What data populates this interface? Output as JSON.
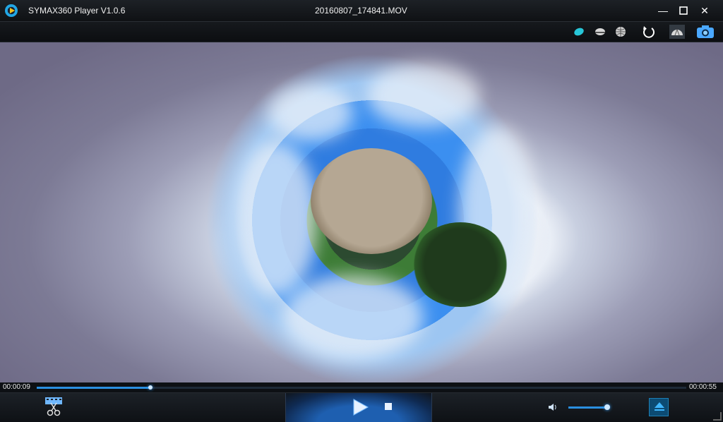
{
  "window": {
    "app_title": "SYMAX360 Player V1.0.6",
    "file_title": "20160807_174841.MOV",
    "minimize_glyph": "—",
    "maximize_glyph": "☐",
    "close_glyph": "✕"
  },
  "toolbar": {
    "buttons": [
      {
        "name": "little-planet-view-icon",
        "color": "#27c6d8"
      },
      {
        "name": "fisheye-view-icon",
        "color": "#d8d8d8"
      },
      {
        "name": "globe-view-icon",
        "color": "#d8d8d8"
      },
      {
        "name": "rotate-reset-icon",
        "color": "#ffffff"
      },
      {
        "name": "dome-view-icon",
        "color": "#d8d8d8"
      },
      {
        "name": "snapshot-camera-icon",
        "color": "#4aa8ff"
      }
    ]
  },
  "playback": {
    "current_time": "00:00:09",
    "total_time": "00:00:55",
    "progress": 0.175,
    "volume": 1.0
  },
  "colors": {
    "accent": "#2a8fe0",
    "panel": "#1c2127"
  }
}
